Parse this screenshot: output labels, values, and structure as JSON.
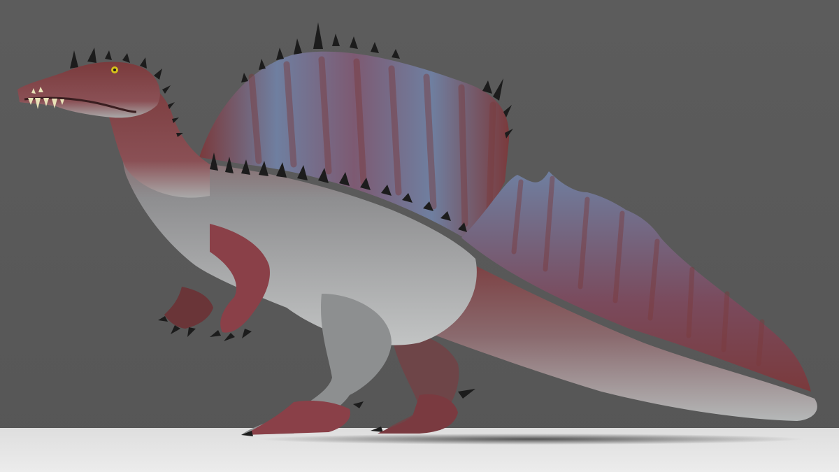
{
  "scene": {
    "subject": "spinosaurus-3d-render",
    "colors": {
      "backdrop": "#5a5a5a",
      "floor": "#e6e6e6",
      "skin_red": "#7a3a3c",
      "skin_blue": "#6f7fa0",
      "belly": "#b9bcbc",
      "spikes": "#1c1c1c",
      "eye": "#d6c21a"
    }
  }
}
